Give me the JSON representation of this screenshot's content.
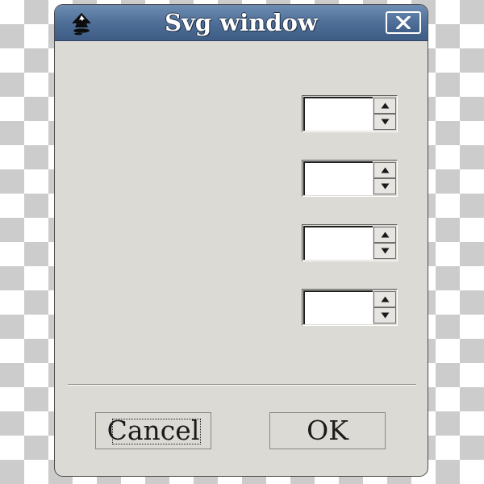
{
  "window": {
    "title": "Svg window",
    "app_icon": "inkscape-logo-icon",
    "close_icon": "close-icon"
  },
  "spinners": [
    {
      "value": ""
    },
    {
      "value": ""
    },
    {
      "value": ""
    },
    {
      "value": ""
    }
  ],
  "buttons": {
    "cancel_label": "Cancel",
    "ok_label": "OK"
  },
  "colors": {
    "titlebar": "#4f6f98",
    "dialog_background": "#dcdad5",
    "entry_background": "#ffffff"
  }
}
